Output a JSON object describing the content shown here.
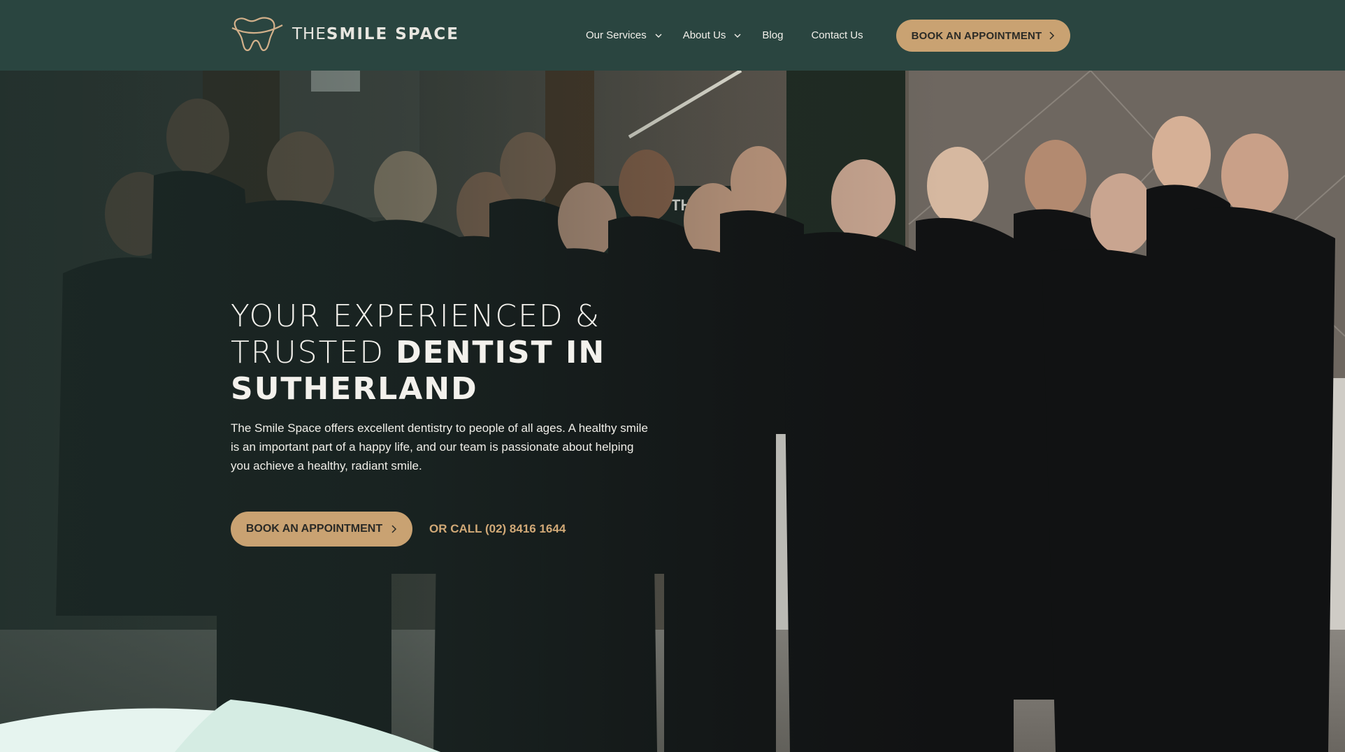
{
  "header": {
    "logo_word_light": "THE",
    "logo_word_bold": "SMILE SPACE",
    "nav": [
      {
        "label": "Our Services",
        "dropdown": true
      },
      {
        "label": "About Us",
        "dropdown": true
      },
      {
        "label": "Blog",
        "dropdown": false
      },
      {
        "label": "Contact Us",
        "dropdown": false
      }
    ],
    "cta_label": "BOOK AN APPOINTMENT"
  },
  "hero": {
    "title_line1": "YOUR EXPERIENCED &",
    "title_line2_light": "TRUSTED ",
    "title_line2_bold": "DENTIST IN",
    "title_line3_bold": "SUTHERLAND",
    "description": "The Smile Space offers excellent dentistry to people of all ages. A healthy smile is an important part of a happy life, and our team is passionate about helping you achieve a healthy, radiant smile.",
    "cta_label": "BOOK AN APPOINTMENT",
    "call_text": "OR CALL (02) 8416 1644",
    "photo_sign_text": "THE SMILE SPACE"
  },
  "colors": {
    "header_bg": "#2a4540",
    "accent": "#c9a272",
    "accent_text": "#d1a977",
    "curve": "#e6f4ef"
  }
}
